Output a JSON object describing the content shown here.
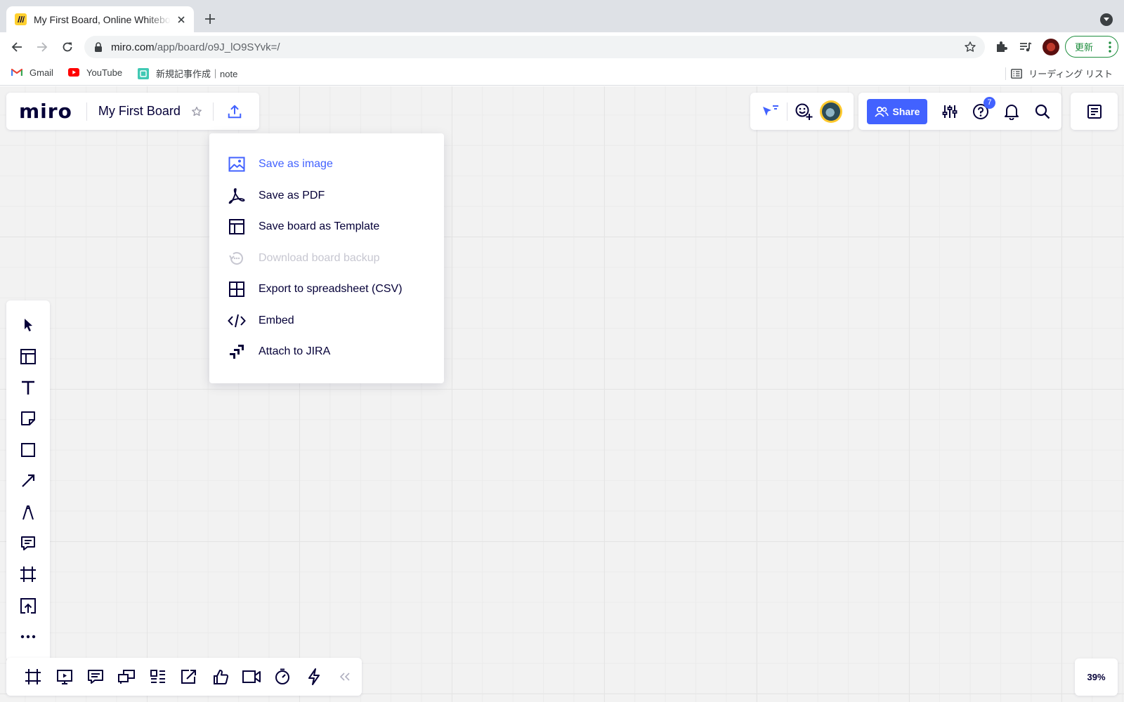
{
  "browser": {
    "tab_title": "My First Board, Online Whiteboard for Visual Collaboration",
    "url_host": "miro.com",
    "url_path": "/app/board/o9J_lO9SYvk=/",
    "update_label": "更新",
    "bookmarks": [
      {
        "label": "Gmail",
        "icon": "gmail-icon"
      },
      {
        "label": "YouTube",
        "icon": "youtube-icon"
      },
      {
        "label": "新規記事作成｜note",
        "icon": "note-icon"
      }
    ],
    "reading_list_label": "リーディング リスト"
  },
  "board": {
    "logo": "miro",
    "title": "My First Board",
    "share_label": "Share",
    "help_badge": "7",
    "zoom": "39%",
    "accent_color": "#4262ff"
  },
  "export_menu": {
    "items": [
      {
        "label": "Save as image",
        "icon": "image-icon",
        "state": "active"
      },
      {
        "label": "Save as PDF",
        "icon": "pdf-icon",
        "state": "normal"
      },
      {
        "label": "Save board as Template",
        "icon": "template-icon",
        "state": "normal"
      },
      {
        "label": "Download board backup",
        "icon": "backup-icon",
        "state": "disabled"
      },
      {
        "label": "Export to spreadsheet (CSV)",
        "icon": "spreadsheet-icon",
        "state": "normal"
      },
      {
        "label": "Embed",
        "icon": "code-icon",
        "state": "normal"
      },
      {
        "label": "Attach to JIRA",
        "icon": "jira-icon",
        "state": "normal"
      }
    ]
  },
  "left_toolbar": [
    "select-tool",
    "templates-tool",
    "text-tool",
    "sticky-note-tool",
    "shape-tool",
    "connection-line-tool",
    "pen-tool",
    "comment-tool",
    "frame-tool",
    "upload-tool",
    "more-tools"
  ],
  "bottom_toolbar": [
    "frames-icon",
    "presentation-icon",
    "comments-icon",
    "video-chat-icon",
    "cards-icon",
    "share-screen-icon",
    "voting-icon",
    "video-icon",
    "timer-icon",
    "activity-icon"
  ]
}
